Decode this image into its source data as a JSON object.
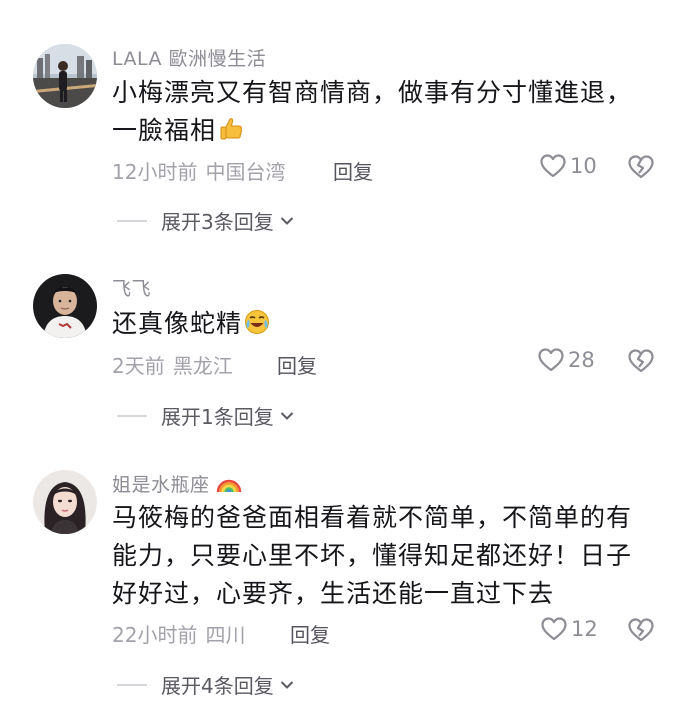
{
  "comments": [
    {
      "username": "LALA 歐洲慢生活",
      "text_lines": [
        "小梅漂亮又有智商情商，做事有分寸懂進退，",
        "一臉福相"
      ],
      "emoji": "thumbs-up",
      "time": "12小时前",
      "location": "中国台湾",
      "reply_label": "回复",
      "likes": "10",
      "expand_label": "展开3条回复"
    },
    {
      "username": "飞飞",
      "text_lines": [
        "还真像蛇精"
      ],
      "emoji": "crying-laughing",
      "time": "2天前",
      "location": "黑龙江",
      "reply_label": "回复",
      "likes": "28",
      "expand_label": "展开1条回复"
    },
    {
      "username": "姐是水瓶座",
      "username_emoji": "rainbow",
      "text_lines": [
        "马筱梅的爸爸面相看着就不简单，不简单的有",
        "能力，只要心里不坏，懂得知足都还好！日子",
        "好好过，心要齐，生活还能一直过下去"
      ],
      "time": "22小时前",
      "location": "四川",
      "reply_label": "回复",
      "likes": "12",
      "expand_label": "展开4条回复"
    }
  ],
  "colors": {
    "username": "#8c8c95",
    "text": "#16161a",
    "meta": "#a2a2aa",
    "reply": "#55555e"
  }
}
